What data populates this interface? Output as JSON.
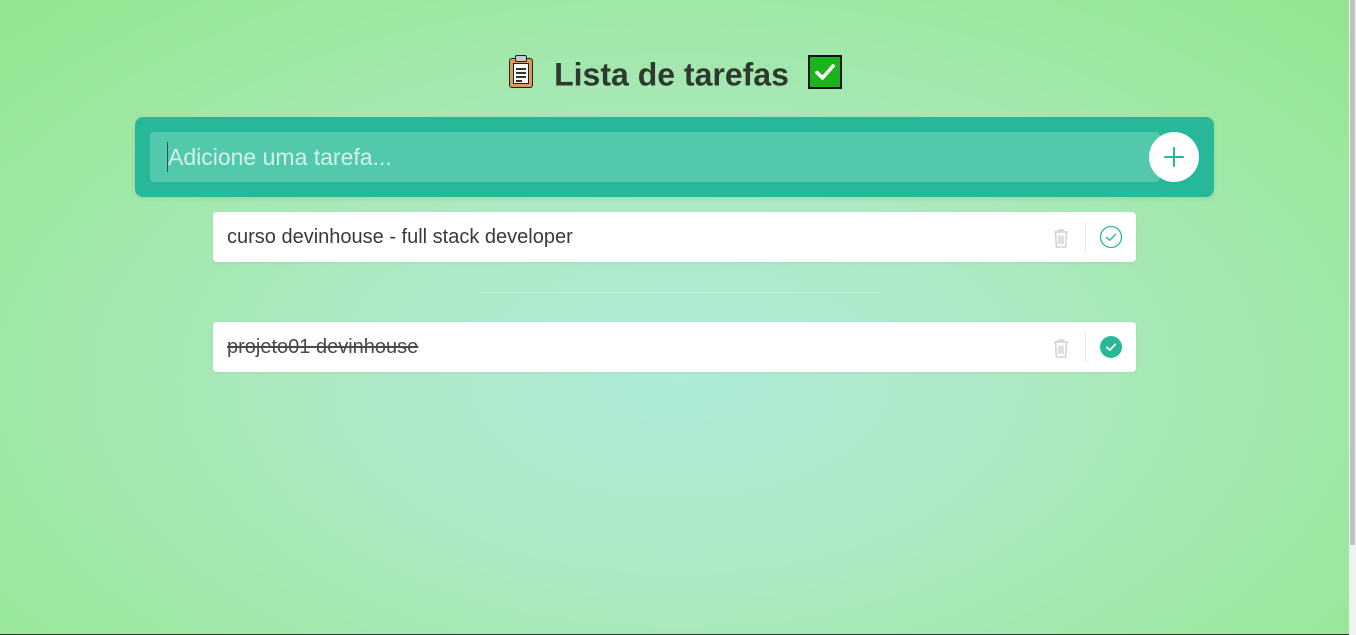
{
  "header": {
    "title": "Lista de tarefas",
    "title_icon_left": "clipboard-emoji",
    "title_icon_right": "check-mark-button-emoji"
  },
  "new_task": {
    "placeholder": "Adicione uma tarefa...",
    "value": "",
    "add_icon": "plus-icon"
  },
  "pending_tasks": [
    {
      "text": "curso devinhouse - full stack developer",
      "completed": false
    }
  ],
  "completed_tasks": [
    {
      "text": "projeto01 devinhouse",
      "completed": true
    }
  ],
  "colors": {
    "accent": "#26b899",
    "input_bg": "#52c8ad",
    "title": "#2e3a30",
    "task_bg": "#ffffff"
  }
}
